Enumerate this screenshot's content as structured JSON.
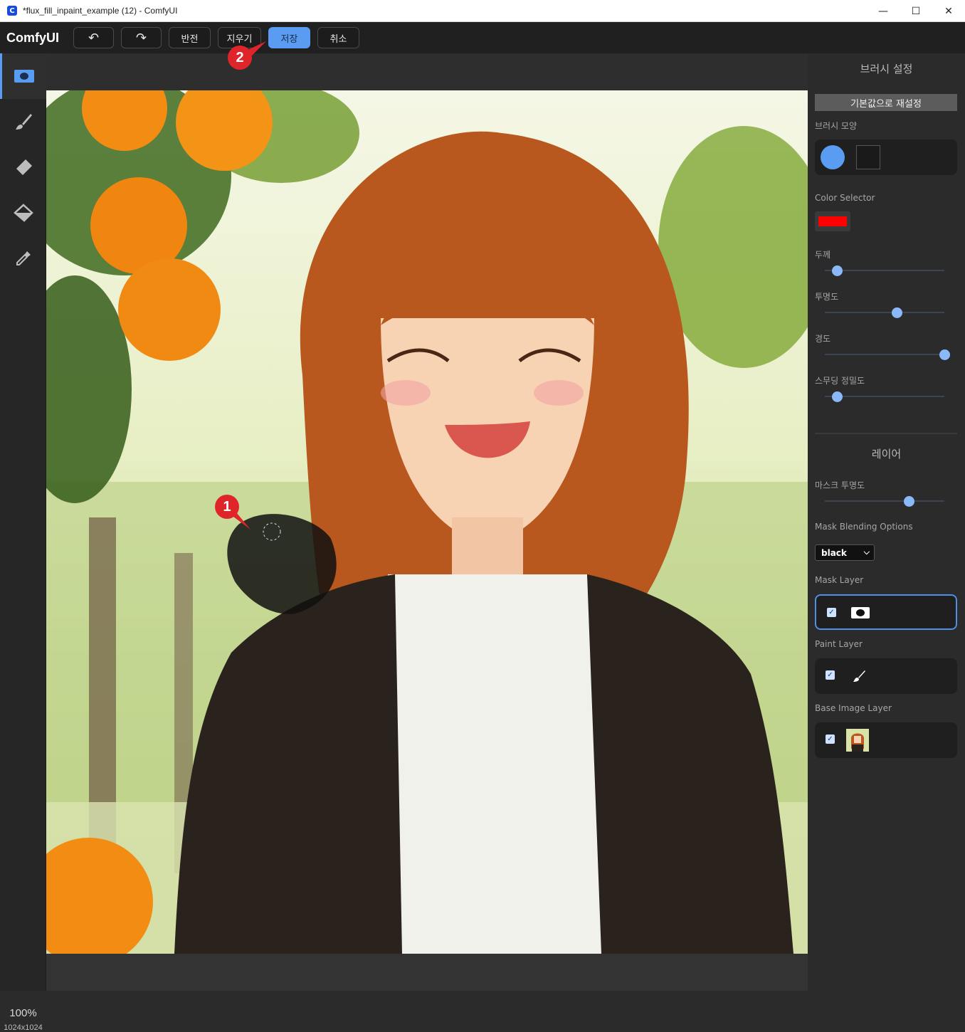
{
  "window": {
    "title": "*flux_fill_inpaint_example (12) - ComfyUI",
    "icon_letter": "C",
    "controls": [
      "—",
      "☐",
      "✕"
    ]
  },
  "toolbar": {
    "brand": "ComfyUI",
    "undo_icon": "↶",
    "redo_icon": "↷",
    "invert_label": "반전",
    "clear_label": "지우기",
    "save_label": "저장",
    "cancel_label": "취소"
  },
  "rail": {
    "zoom": "100%",
    "dimensions": "1024x1024"
  },
  "panel": {
    "brush_settings_title": "브러시 설정",
    "reset_label": "기본값으로 재설정",
    "brush_shape_label": "브러시 모양",
    "color_selector_label": "Color Selector",
    "color_value": "#ff0000",
    "thickness_label": "두께",
    "opacity_label": "투명도",
    "hardness_label": "경도",
    "smoothing_label": "스무딩 정밀도",
    "layers_title": "레이어",
    "mask_opacity_label": "마스크 투명도",
    "blending_label": "Mask Blending Options",
    "blending_value": "black",
    "mask_layer_label": "Mask Layer",
    "paint_layer_label": "Paint Layer",
    "base_image_label": "Base Image Layer",
    "sliders": {
      "thickness": 0.1,
      "opacity": 0.6,
      "hardness": 1.0,
      "smoothing": 0.1,
      "mask_opacity": 0.7
    }
  },
  "annotations": {
    "badge_1": "1",
    "badge_2": "2"
  },
  "colors": {
    "accent": "#5a9cf2",
    "badge": "#e0252a"
  }
}
